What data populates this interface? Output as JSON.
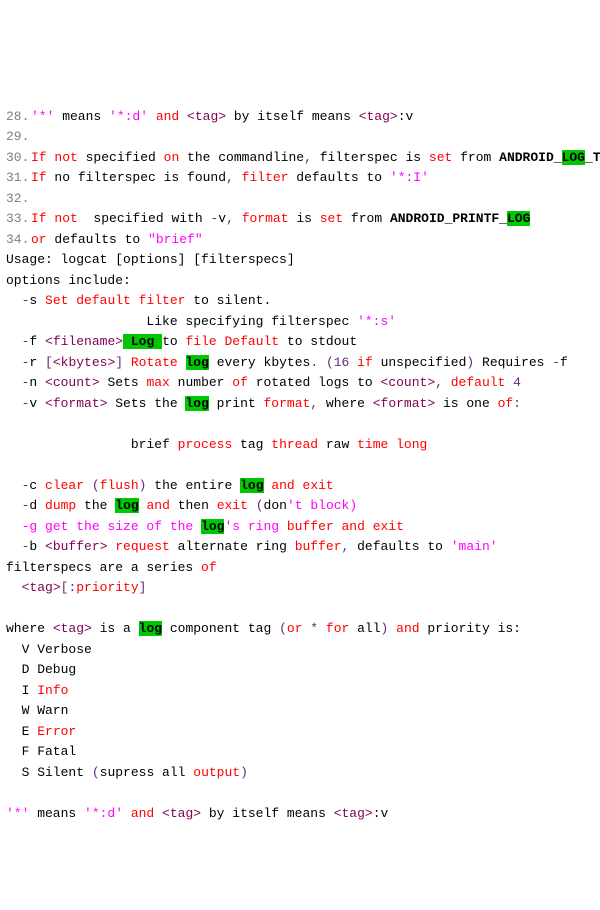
{
  "t": {
    "star": "'*'",
    "meansA": " means ",
    "stardA": "'*:d'",
    "and1": " and ",
    "tag": "<tag>",
    "byitself": " by itself means ",
    "tagv": "<tag>",
    "l30a": "If",
    "not": " not ",
    "spec": "specified ",
    "on": "on",
    "cmd": " the commandline",
    "c1": ",",
    "filterspec": " filterspec is ",
    "set": "set",
    "from": " from ",
    "alog": "ANDROID_",
    "log": "LOG",
    "_tag": "_TAG",
    "l31a": "If",
    "l31b": " no filterspec is found",
    "c2": ",",
    "filter": " filter ",
    "defto": "defaults to ",
    "starI": "'*:I'",
    "l33a": "If",
    "l33b": " specified with ",
    "dv": "-",
    "l33c": "v",
    "c3": ",",
    "format": " format ",
    "is": "is ",
    "set2": "set",
    "from2": " from ",
    "ap": "ANDROID_",
    "pr": "PRINTF_",
    "log2": "LOG",
    "l34a": "or",
    "l34b": " defaults to ",
    "brief": "\"brief\"",
    "usage": "Usage: logcat [options] [filterspecs]",
    "optinc": "options include:",
    "sflag": "-",
    "ss": "s ",
    "Set": "Set",
    "deffil": " default ",
    "filterw": "filter",
    "tosil": " to silent.",
    "like": "                  Like specifying filterspec ",
    "stars": "'*:s'",
    "fflag": "-",
    "ff": "f ",
    "fn": "<filename>",
    "Log": " Log ",
    "to": "to ",
    "file": "file",
    ".": ".",
    "def2": " Default ",
    "std": "to stdout",
    "rflag": "-",
    "rr": "r ",
    "lb": "[",
    "kby": "<kbytes>",
    "rb": "]",
    "Rot": " Rotate ",
    "log3": "log",
    "ev": " every kbytes",
    "dot": ".",
    "p1": " (",
    "n16": "16",
    "if": " if ",
    "unsp": "unspecified",
    ")": "",
    ".2": ".",
    "req": " Requires ",
    "mf": "-",
    "ff2": "f",
    "nflag": "-",
    "nn": "n ",
    "cnt": "<count>",
    "Sets": " Sets ",
    "max": "max",
    "num": " number ",
    "of": "of",
    "rot": " rotated logs to ",
    "cnt2": "<count>",
    ",": "",
    "def4": " default ",
    "four": "4",
    "vflag": "-",
    "vv": "v ",
    "fmt": "<format>",
    "Sets2": " Sets the ",
    "log4": "log",
    "prfmt": " print ",
    "format2": "format",
    ",2": "",
    "wh": " where ",
    "fmt2": "<format>",
    "isone": " is one ",
    "of2": "of",
    ":": "",
    "briefw": "brief ",
    "proc": "process",
    "tagw": " tag ",
    "thread": "thread",
    "raw": " raw ",
    "time": "time",
    "longw": " long",
    "cflag": "-",
    "cc": "c ",
    "clear": "clear",
    "sp2": " (",
    "flush": "flush",
    ")2": ")",
    "ent": " the entire ",
    "log5": "log",
    "and2": " and ",
    "exit": "exit",
    "dflag": "-",
    "dd": "d ",
    "dump": "dump",
    "the": " the ",
    "log6": "log",
    "and3": " and ",
    "then": "then ",
    "exit2": "exit",
    "sp3": " (",
    "don": "don",
    "tblk": "'t block)",
    "gflag": "-g get the size of the ",
    "log7": "log",
    "ring": "'s ring ",
    "buffer": "buffer",
    "and4": " and ",
    "exit3": "exit",
    "bflag": "-",
    "bb": "b ",
    "buf": "<buffer>",
    "req2": " request ",
    "alt": "alternate ring ",
    "buffer2": "buffer",
    ",3": "",
    "defto2": " defaults to ",
    "main": "'main'",
    "fsa": "filterspecs are a series ",
    "of3": "of",
    "tag2": "<tag>",
    "lb2": "[",
    ":p": ":",
    "prior": "priority",
    "rb2": "]",
    "wh2": "where ",
    "tag3": "<tag>",
    "isa": " is a ",
    "log8": "log",
    "comp": " component ",
    "tag4": "tag",
    "sp4": " (",
    "or": "or",
    "star2": " * ",
    "for": "for",
    "all": " all",
    ")3": ")",
    "and5": " and ",
    "pri": "priority is:",
    "V": "  V Verbose",
    "D": "  D Debug",
    "I": "  I ",
    "Info": "Info",
    "W": "  W Warn",
    "E": "  E ",
    "Err": "Error",
    "F": "  F Fatal",
    "S": "  S Silent ",
    "sp5": "(",
    "sup": "supress all ",
    "out": "output",
    ")4": ")",
    "starB": "'*'",
    "meansB": " means ",
    "stardB": "'*:d'",
    "and6": " and ",
    "tagB": "<tag>",
    "byit2": " by itself means ",
    "tagvB": "<tag>"
  }
}
